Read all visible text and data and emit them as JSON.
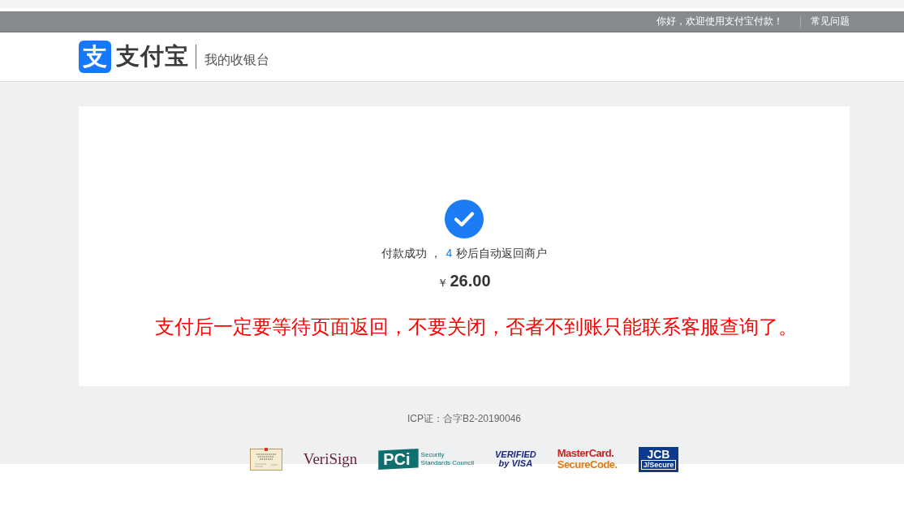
{
  "top_bar": {
    "greeting": "你好，欢迎使用支付宝付款！",
    "help_link": "常见问题"
  },
  "header": {
    "logo_mark": "支",
    "brand": "支付宝",
    "subtitle": "我的收银台"
  },
  "result": {
    "success": true,
    "message": {
      "before": "付款成功 ，",
      "countdown": "4",
      "after": "秒后自动返回商户"
    },
    "currency": "￥",
    "amount": "26.00",
    "warning": "支付后一定要等待页面返回，不要关闭，否者不到账只能联系客服查询了。"
  },
  "footer": {
    "icp": "ICP证：合字B2-20190046",
    "badges": [
      {
        "kind": "certificate"
      },
      {
        "kind": "verisign",
        "lines": [
          "VeriSign"
        ]
      },
      {
        "kind": "pci",
        "lines": [
          "PCi",
          "Security",
          "Standards Council"
        ]
      },
      {
        "kind": "visa",
        "lines": [
          "VERIFIED",
          "by VISA"
        ]
      },
      {
        "kind": "mastercard",
        "lines": [
          "MasterCard.",
          "SecureCode."
        ]
      },
      {
        "kind": "jcb",
        "lines": [
          "JCB",
          "J/Secure"
        ]
      }
    ]
  }
}
